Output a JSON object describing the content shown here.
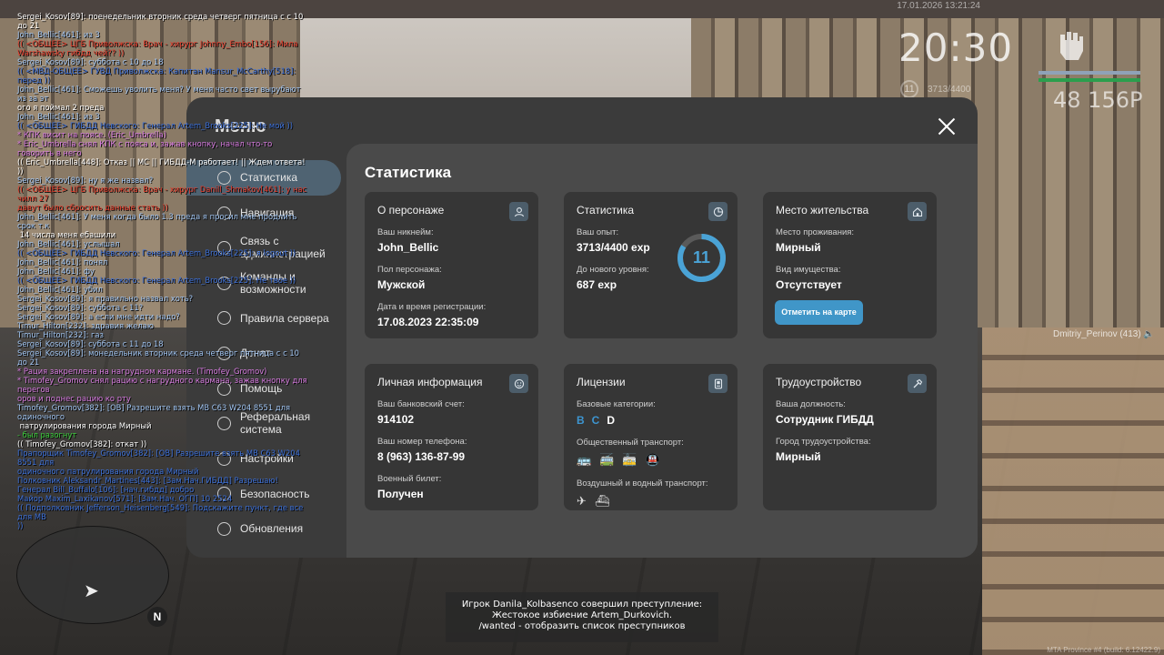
{
  "hud": {
    "datetime": "17.01.2026 13:21:24",
    "time": "20:30",
    "level": "11",
    "exp": "3713/4400",
    "money": "48 156P"
  },
  "chat": [
    {
      "text": "Sergei_Kosov[89]: поенедельник вторник среда четверг пятница с с 10 до 21",
      "color": "#ffffff"
    },
    {
      "text": "John_Bellic[461]: из 3",
      "color": "#9fc3f0"
    },
    {
      "text": "(( <ОБЩЕЕ> ЦГБ Приволжска: Врач - хирург Johnny_Embo[156]: Мила",
      "color": "#e23a2a"
    },
    {
      "text": "Warshawsky гибдд чей?? ))",
      "color": "#e23a2a"
    },
    {
      "text": "Sergei_Kosov[89]: суббота с 10 до 18",
      "color": "#9fc3f0"
    },
    {
      "text": "(( <МВД-ОБЩЕЕ> ГУВД Приволжска: Капитан Mansur_McCarthy[518]: перед ))",
      "color": "#3b6fd8"
    },
    {
      "text": "John_Bellic[461]: Сможешь уволить меня? У меня часто свет вырубают из за эт",
      "color": "#9fc3f0"
    },
    {
      "text": "ого я поймал 2 преда",
      "color": "#ffffff"
    },
    {
      "text": "John_Bellic[461]: из 3",
      "color": "#9fc3f0"
    },
    {
      "text": "(( <ОБЩЕЕ> ГИБДД Невского: Генерал Artem_Brooks[225]: Не мой ))",
      "color": "#3b6fd8"
    },
    {
      "text": "* КПК висит на поясе. (Eric_Umbrella)",
      "color": "#d77be0"
    },
    {
      "text": "* Eric_Umbrella снял КПК с пояса и, зажав кнопку, начал что-то говорить в него",
      "color": "#d77be0"
    },
    {
      "text": "(( Eric_Umbrella[448]: Отказ || МС || ГИБДД-М работает! || Ждем ответа! ))",
      "color": "#ffffff"
    },
    {
      "text": "Sergei_Kosov[89]: ну я же назвал?",
      "color": "#9fc3f0"
    },
    {
      "text": "(( <ОБЩЕЕ> ЦГБ Приволжска: Врач - хирург Danill_Shmakov[461]: у нас чилл 27",
      "color": "#e23a2a"
    },
    {
      "text": "давут было сбросить данные стать ))",
      "color": "#e23a2a"
    },
    {
      "text": "John_Bellic[461]: У меня когда было 1.3 преда я просил мне продлить срок т.к",
      "color": "#9fc3f0"
    },
    {
      "text": " 14 числа меня ебашили",
      "color": "#ffffff"
    },
    {
      "text": "John_Bellic[461]: услышал",
      "color": "#9fc3f0"
    },
    {
      "text": "(( <ОБЩЕЕ> ГИБДД Невского: Генерал Artem_Brooks[225]: я logout ))",
      "color": "#3b6fd8"
    },
    {
      "text": "John_Bellic[461]: понял",
      "color": "#9fc3f0"
    },
    {
      "text": "John_Bellic[461]: фу",
      "color": "#9fc3f0"
    },
    {
      "text": "(( <ОБЩЕЕ> ГИБДД Невского: Генерал Artem_Brooks[225]: Не твое ))",
      "color": "#3b6fd8"
    },
    {
      "text": "John_Bellic[461]: убил",
      "color": "#9fc3f0"
    },
    {
      "text": "Sergei_Kosov[89]: я правильно назвал хоть?",
      "color": "#9fc3f0"
    },
    {
      "text": "Sergei_Kosov[89]: суббота с 11?",
      "color": "#9fc3f0"
    },
    {
      "text": "Sergei_Kosov[89]: а если мне идти надо?",
      "color": "#9fc3f0"
    },
    {
      "text": "Timur_Hilton[232]: здравия желаю",
      "color": "#9fc3f0"
    },
    {
      "text": "Timur_Hilton[232]: газ",
      "color": "#9fc3f0"
    },
    {
      "text": "Sergei_Kosov[89]: суббота с 11 до 18",
      "color": "#9fc3f0"
    },
    {
      "text": "Sergei_Kosov[89]: монедельник вторник среда четверг пятница с с 10 до 21",
      "color": "#9fc3f0"
    },
    {
      "text": "* Рация закреплена на нагрудном кармане. (Timofey_Gromov)",
      "color": "#d77be0"
    },
    {
      "text": "* Timofey_Gromov снял рацию с нагрудного кармана, зажав кнопку для перегов",
      "color": "#d77be0"
    },
    {
      "text": "оров и поднес рацию ко рту",
      "color": "#d77be0"
    },
    {
      "text": "Timofey_Gromov[382]: [ОВ] Разрешите взять МВ С63 W204 8551 для одиночного",
      "color": "#9fc3f0"
    },
    {
      "text": " патрулирования города Мирный",
      "color": "#ffffff"
    },
    {
      "text": "- был разогнут",
      "color": "#3ad03a"
    },
    {
      "text": "(( Timofey_Gromov[382]: откат ))",
      "color": "#ffffff"
    },
    {
      "text": "Прапорщик Timofey_Gromov[382]: [ОВ] Разрешите взять МВ С63 W204 8551 для",
      "color": "#3b6fd8"
    },
    {
      "text": "одиночного патрулирования города Мирный",
      "color": "#3b6fd8"
    },
    {
      "text": "Полковник Aleksandr_Martines[443]: [Зам.Нач.ГИБДД] Разрешаю!",
      "color": "#3b6fd8"
    },
    {
      "text": "Генерал Bill_Buffalo[106]: [нач.гибдд] добро",
      "color": "#3b6fd8"
    },
    {
      "text": "Майор Maxim_Laxikanov[571]: [Зам.Нач. ОГП] 10 2524",
      "color": "#3b6fd8"
    },
    {
      "text": "(( Подполковник Jefferson_Heisenberg[549]: Подскажите пункт, где все для МВ",
      "color": "#3b6fd8"
    },
    {
      "text": "))",
      "color": "#3b6fd8"
    }
  ],
  "menu": {
    "title": "Меню",
    "nav": [
      {
        "label": "Статистика",
        "icon": "chart-icon"
      },
      {
        "label": "Навигация",
        "icon": "compass-icon"
      },
      {
        "label": "Связь с администрацией",
        "icon": "headset-icon"
      },
      {
        "label": "Команды и возможности",
        "icon": "document-icon"
      },
      {
        "label": "Правила сервера",
        "icon": "book-icon"
      },
      {
        "label": "Донат",
        "icon": "wallet-icon"
      },
      {
        "label": "Помощь",
        "icon": "help-icon"
      },
      {
        "label": "Реферальная система",
        "icon": "people-icon"
      },
      {
        "label": "Настройки",
        "icon": "gear-icon"
      },
      {
        "label": "Безопасность",
        "icon": "shield-icon"
      },
      {
        "label": "Обновления",
        "icon": "refresh-icon"
      }
    ]
  },
  "stats": {
    "heading": "Статистика",
    "character": {
      "title": "О персонаже",
      "nick_label": "Ваш никнейм:",
      "nick": "John_Bellic",
      "gender_label": "Пол персонажа:",
      "gender": "Мужской",
      "reg_label": "Дата и время регистрации:",
      "reg": "17.08.2023 22:35:09"
    },
    "statistics": {
      "title": "Статистика",
      "exp_label": "Ваш опыт:",
      "exp": "3713/4400 exp",
      "next_label": "До нового уровня:",
      "next": "687 exp",
      "level": "11",
      "progress": 0.84
    },
    "residence": {
      "title": "Место жительства",
      "place_label": "Место проживания:",
      "place": "Мирный",
      "property_label": "Вид имущества:",
      "property": "Отсутствует",
      "button": "Отметить на карте"
    },
    "personal": {
      "title": "Личная информация",
      "bank_label": "Ваш банковский счет:",
      "bank": "914102",
      "phone_label": "Ваш номер телефона:",
      "phone": "8 (963) 136-87-99",
      "military_label": "Военный билет:",
      "military": "Получен"
    },
    "licenses": {
      "title": "Лицензии",
      "base_label": "Базовые категории:",
      "categories": [
        "B",
        "C",
        "D"
      ],
      "public_label": "Общественный транспорт:",
      "air_label": "Воздушный и водный транспорт:"
    },
    "job": {
      "title": "Трудоустройство",
      "position_label": "Ваша должность:",
      "position": "Сотрудник ГИБДД",
      "city_label": "Город трудоустройства:",
      "city": "Мирный"
    }
  },
  "player_tag": "Dmitriy_Perinov (413)",
  "notice": {
    "line1": "Игрок Danila_Kolbasenco совершил преступление:",
    "line2": "Жестокое избиение Artem_Durkovich.",
    "line3": "/wanted - отобразить список преступников"
  },
  "build": "MTA Province #4 (build: 6.12422.9)",
  "colors": {
    "accent": "#4096c8",
    "panel": "#3b3b3b",
    "card": "#363636"
  }
}
